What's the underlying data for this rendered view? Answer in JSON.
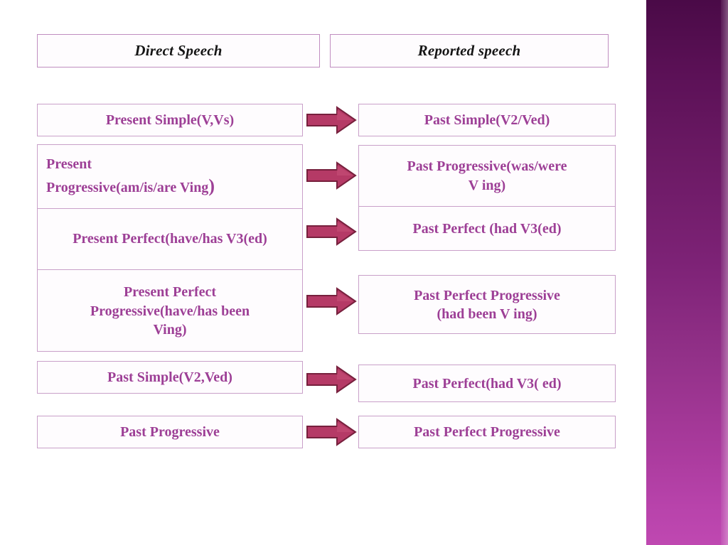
{
  "slide": {
    "background_color": "#ffffff",
    "accent_bar": {
      "gradient_top": "#4a0a47",
      "gradient_bottom": "#bf48b1"
    },
    "text_color": "#9d3f96",
    "header_text_color": "#151515",
    "border_color": "#c9a0c9",
    "arrow_fill": "#b53a66",
    "arrow_stroke": "#7d2040"
  },
  "headers": {
    "left": "Direct Speech",
    "right": "Reported speech"
  },
  "left_column": [
    {
      "text": "Present Simple(V,Vs)"
    },
    {
      "line1": "Present",
      "line2": "Progressive(am/is/are Ving",
      "paren": ")"
    },
    {
      "text": "Present Perfect(have/has V3(ed)"
    },
    {
      "line1": "Present Perfect",
      "line2": "Progressive(have/has been",
      "line3": "Ving)"
    },
    {
      "text": "Past Simple(V2,Ved)"
    },
    {
      "text": "Past Progressive"
    }
  ],
  "right_column": [
    {
      "text": "Past Simple(V2/Ved)"
    },
    {
      "line1": "Past Progressive(was/were",
      "line2": "V  ing)"
    },
    {
      "text": "Past Perfect (had V3(ed)"
    },
    {
      "line1": "Past Perfect Progressive",
      "line2": "(had been V ing)"
    },
    {
      "text": "Past Perfect(had V3( ed)"
    },
    {
      "text": "Past Perfect Progressive"
    }
  ],
  "arrows": {
    "icon": "right-block-arrow-icon",
    "count": 6
  }
}
